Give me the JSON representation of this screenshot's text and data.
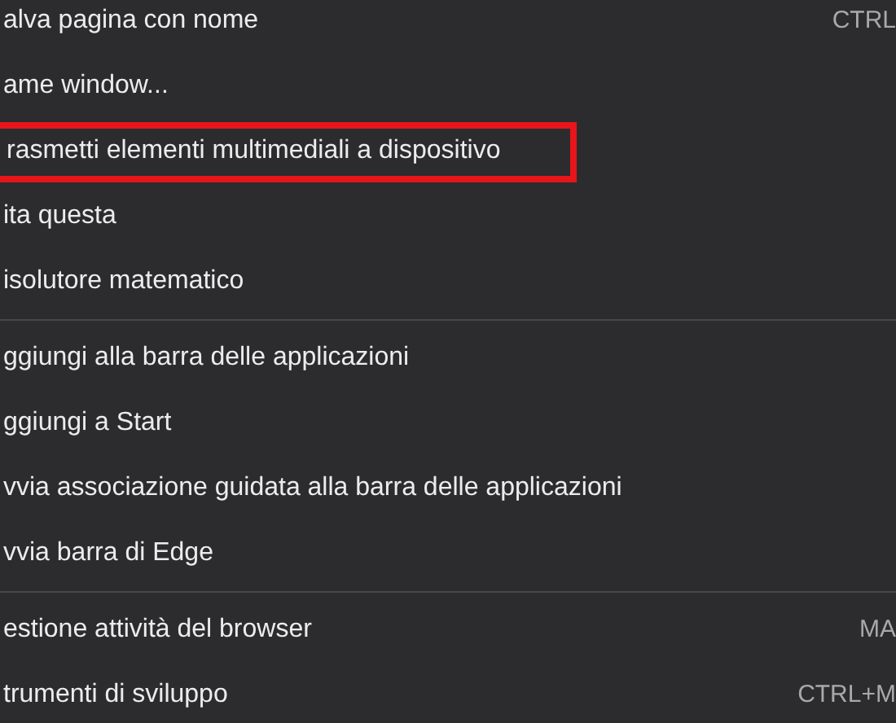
{
  "menu": {
    "groups": [
      {
        "items": [
          {
            "label": "alva pagina con nome",
            "shortcut": "CTRL",
            "highlighted": false
          },
          {
            "label": "ame window...",
            "highlighted": false
          },
          {
            "label": "rasmetti elementi multimediali a dispositivo",
            "highlighted": true
          },
          {
            "label": "ita questa",
            "highlighted": false
          },
          {
            "label": "isolutore matematico",
            "highlighted": false
          }
        ]
      },
      {
        "items": [
          {
            "label": "ggiungi alla barra delle applicazioni",
            "highlighted": false
          },
          {
            "label": "ggiungi a Start",
            "highlighted": false
          },
          {
            "label": "vvia associazione guidata alla barra delle applicazioni",
            "highlighted": false
          },
          {
            "label": "vvia barra di Edge",
            "highlighted": false
          }
        ]
      },
      {
        "items": [
          {
            "label": "estione attività del browser",
            "shortcut": "MA",
            "highlighted": false
          },
          {
            "label": "trumenti di sviluppo",
            "shortcut": "CTRL+M",
            "highlighted": false
          }
        ]
      }
    ]
  }
}
